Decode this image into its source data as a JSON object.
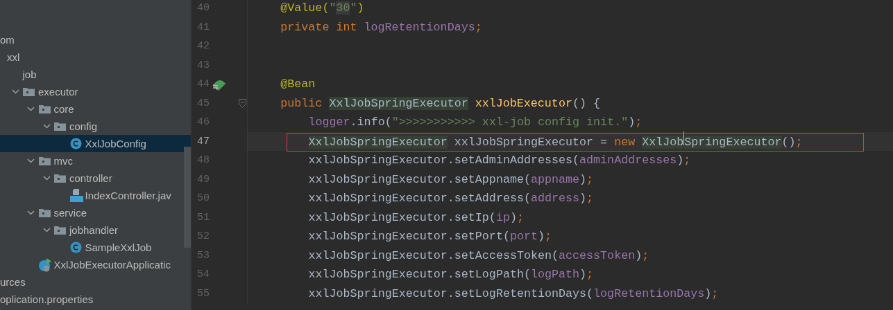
{
  "project_tree": [
    {
      "label": "om",
      "selected": false,
      "children": [
        {
          "label": "xxl",
          "selected": false,
          "children": [
            {
              "label": "job",
              "selected": false,
              "children": [
                {
                  "label": "executor",
                  "kind": "package",
                  "expanded": true,
                  "selected": false,
                  "children": [
                    {
                      "label": "core",
                      "kind": "package",
                      "expanded": true,
                      "selected": false,
                      "children": [
                        {
                          "label": "config",
                          "kind": "package",
                          "expanded": true,
                          "selected": false,
                          "children": [
                            {
                              "label": "XxlJobConfig",
                              "kind": "class",
                              "selected": true
                            }
                          ]
                        }
                      ]
                    },
                    {
                      "label": "mvc",
                      "kind": "package",
                      "expanded": true,
                      "selected": false,
                      "children": [
                        {
                          "label": "controller",
                          "kind": "package",
                          "expanded": true,
                          "selected": false,
                          "children": [
                            {
                              "label": "IndexController.jav",
                              "kind": "java-file",
                              "selected": false
                            }
                          ]
                        }
                      ]
                    },
                    {
                      "label": "service",
                      "kind": "package",
                      "expanded": true,
                      "selected": false,
                      "children": [
                        {
                          "label": "jobhandler",
                          "kind": "package",
                          "expanded": true,
                          "selected": false,
                          "children": [
                            {
                              "label": "SampleXxlJob",
                              "kind": "class",
                              "selected": false
                            }
                          ]
                        }
                      ]
                    },
                    {
                      "label": "XxlJobExecutorApplicatic",
                      "kind": "app",
                      "selected": false
                    }
                  ]
                }
              ]
            }
          ]
        }
      ]
    },
    {
      "label": "urces",
      "selected": false
    },
    {
      "label": "oplication.properties",
      "selected": false
    }
  ],
  "editor": {
    "lines": [
      {
        "number": "40",
        "kind": "plain",
        "indented": false,
        "current": false,
        "boxed": false,
        "tokens": [
          {
            "text": "@Value(",
            "kind": "annotation"
          },
          {
            "text": "\"",
            "kind": "string"
          },
          {
            "text": "30",
            "kind": "string-marked"
          },
          {
            "text": "\"",
            "kind": "string"
          },
          {
            "text": ")",
            "kind": "annotation"
          }
        ]
      },
      {
        "number": "41",
        "kind": "plain",
        "indented": false,
        "current": false,
        "boxed": false,
        "tokens": [
          {
            "text": "private int ",
            "kind": "keyword"
          },
          {
            "text": "logRetentionDays",
            "kind": "field"
          },
          {
            "text": ";",
            "kind": "keyword"
          }
        ]
      },
      {
        "number": "42",
        "kind": "plain",
        "current": false,
        "boxed": false
      },
      {
        "number": "43",
        "kind": "plain",
        "current": false,
        "boxed": false
      },
      {
        "number": "44",
        "kind": "bean",
        "indented": false,
        "current": false,
        "boxed": false,
        "tokens": [
          {
            "text": "@Bean",
            "kind": "annotation"
          }
        ]
      },
      {
        "number": "45",
        "kind": "fold",
        "indented": false,
        "current": false,
        "boxed": false,
        "tokens": [
          {
            "text": "public ",
            "kind": "keyword"
          },
          {
            "text": "XxlJobSpringExecutor",
            "kind": "usage"
          },
          {
            "text": " xxlJobExecutor",
            "kind": "method"
          },
          {
            "text": "() {",
            "kind": "plain"
          }
        ]
      },
      {
        "number": "46",
        "kind": "plain",
        "indented": true,
        "current": false,
        "boxed": false,
        "tokens": [
          {
            "text": "logger",
            "kind": "field"
          },
          {
            "text": ".info(",
            "kind": "plain"
          },
          {
            "text": "\">>>>>>>>>>> xxl-job config init.\"",
            "kind": "string"
          },
          {
            "text": ")",
            "kind": "plain"
          },
          {
            "text": ";",
            "kind": "keyword"
          }
        ]
      },
      {
        "number": "47",
        "kind": "plain",
        "indented": true,
        "current": true,
        "boxed": true,
        "tokens": [
          {
            "text": "XxlJobSpringExecutor",
            "kind": "usage"
          },
          {
            "text": " xxlJobSpringExecutor = ",
            "kind": "plain"
          },
          {
            "text": "new ",
            "kind": "keyword"
          },
          {
            "text": "XxlJob",
            "kind": "usage"
          },
          {
            "kind": "caret"
          },
          {
            "text": "SpringExecutor",
            "kind": "usage"
          },
          {
            "text": "()",
            "kind": "plain"
          },
          {
            "text": ";",
            "kind": "keyword"
          }
        ]
      },
      {
        "number": "48",
        "kind": "plain",
        "indented": true,
        "current": false,
        "boxed": false,
        "tokens": [
          {
            "text": "xxlJobSpringExecutor.setAdminAddresses(",
            "kind": "plain"
          },
          {
            "text": "adminAddresses",
            "kind": "field"
          },
          {
            "text": ")",
            "kind": "plain"
          },
          {
            "text": ";",
            "kind": "keyword"
          }
        ]
      },
      {
        "number": "49",
        "kind": "plain",
        "indented": true,
        "current": false,
        "boxed": false,
        "tokens": [
          {
            "text": "xxlJobSpringExecutor.setAppname(",
            "kind": "plain"
          },
          {
            "text": "appname",
            "kind": "field"
          },
          {
            "text": ")",
            "kind": "plain"
          },
          {
            "text": ";",
            "kind": "keyword"
          }
        ]
      },
      {
        "number": "50",
        "kind": "plain",
        "indented": true,
        "current": false,
        "boxed": false,
        "tokens": [
          {
            "text": "xxlJobSpringExecutor.setAddress(",
            "kind": "plain"
          },
          {
            "text": "address",
            "kind": "field"
          },
          {
            "text": ")",
            "kind": "plain"
          },
          {
            "text": ";",
            "kind": "keyword"
          }
        ]
      },
      {
        "number": "51",
        "kind": "plain",
        "indented": true,
        "current": false,
        "boxed": false,
        "tokens": [
          {
            "text": "xxlJobSpringExecutor.setIp(",
            "kind": "plain"
          },
          {
            "text": "ip",
            "kind": "field"
          },
          {
            "text": ")",
            "kind": "plain"
          },
          {
            "text": ";",
            "kind": "keyword"
          }
        ]
      },
      {
        "number": "52",
        "kind": "plain",
        "indented": true,
        "current": false,
        "boxed": false,
        "tokens": [
          {
            "text": "xxlJobSpringExecutor.setPort(",
            "kind": "plain"
          },
          {
            "text": "port",
            "kind": "field"
          },
          {
            "text": ")",
            "kind": "plain"
          },
          {
            "text": ";",
            "kind": "keyword"
          }
        ]
      },
      {
        "number": "53",
        "kind": "plain",
        "indented": true,
        "current": false,
        "boxed": false,
        "tokens": [
          {
            "text": "xxlJobSpringExecutor.setAccessToken(",
            "kind": "plain"
          },
          {
            "text": "accessToken",
            "kind": "field"
          },
          {
            "text": ")",
            "kind": "plain"
          },
          {
            "text": ";",
            "kind": "keyword"
          }
        ]
      },
      {
        "number": "54",
        "kind": "plain",
        "indented": true,
        "current": false,
        "boxed": false,
        "tokens": [
          {
            "text": "xxlJobSpringExecutor.setLogPath(",
            "kind": "plain"
          },
          {
            "text": "logPath",
            "kind": "field"
          },
          {
            "text": ")",
            "kind": "plain"
          },
          {
            "text": ";",
            "kind": "keyword"
          }
        ]
      },
      {
        "number": "55",
        "kind": "plain",
        "indented": true,
        "current": false,
        "boxed": false,
        "tokens": [
          {
            "text": "xxlJobSpringExecutor.setLogRetentionDays(",
            "kind": "plain"
          },
          {
            "text": "logRetentionDays",
            "kind": "field"
          },
          {
            "text": ")",
            "kind": "plain"
          },
          {
            "text": ";",
            "kind": "keyword"
          }
        ]
      }
    ]
  }
}
